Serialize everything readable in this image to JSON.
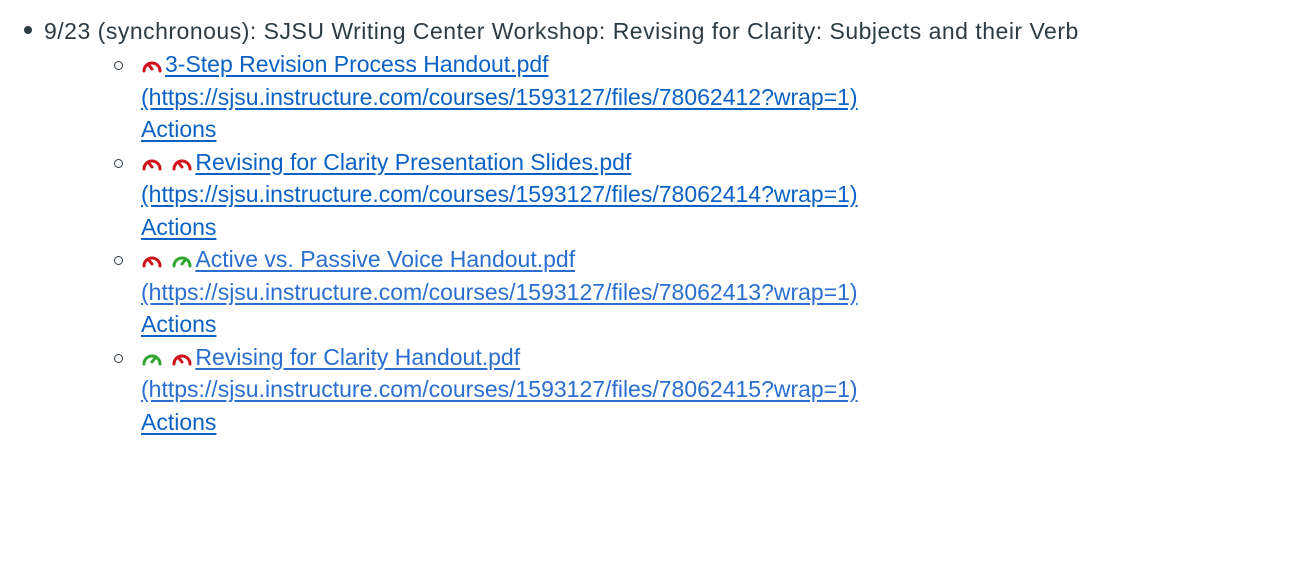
{
  "outer_item": {
    "text": "9/23 (synchronous):  SJSU Writing Center Workshop: Revising for Clarity: Subjects and their Verb"
  },
  "colors": {
    "link": "#0b62c4",
    "gauge_red": "#d0101b",
    "gauge_green": "#2ea62e",
    "text": "#2d3b45"
  },
  "files": [
    {
      "title": "3-Step Revision Process Handout.pdf",
      "url": "(https://sjsu.instructure.com/courses/1593127/files/78062412?wrap=1)",
      "actions": "Actions",
      "indicators": [
        "red-gauge-icon"
      ]
    },
    {
      "title": "Revising for Clarity Presentation Slides.pdf",
      "url": "(https://sjsu.instructure.com/courses/1593127/files/78062414?wrap=1)",
      "actions": "Actions",
      "indicators": [
        "red-gauge-icon",
        "red-gauge-icon"
      ]
    },
    {
      "title": "Active vs. Passive Voice Handout.pdf",
      "url": "(https://sjsu.instructure.com/courses/1593127/files/78062413?wrap=1)",
      "actions": "Actions",
      "indicators": [
        "red-gauge-icon",
        "green-gauge-icon"
      ]
    },
    {
      "title": "Revising for Clarity Handout.pdf",
      "url": "(https://sjsu.instructure.com/courses/1593127/files/78062415?wrap=1)",
      "actions": "Actions",
      "indicators": [
        "green-gauge-icon",
        "red-gauge-icon"
      ]
    }
  ]
}
